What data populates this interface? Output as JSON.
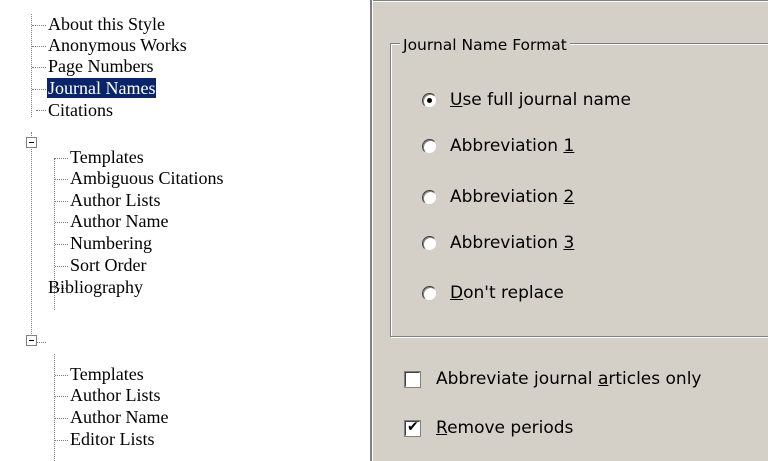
{
  "tree": {
    "items": [
      {
        "label": "About this Style"
      },
      {
        "label": "Anonymous Works"
      },
      {
        "label": "Page Numbers"
      },
      {
        "label": "Journal Names",
        "selected": true
      },
      {
        "label": "Citations",
        "expanded": true
      },
      {
        "label": "Templates"
      },
      {
        "label": "Ambiguous Citations"
      },
      {
        "label": "Author Lists"
      },
      {
        "label": "Author Name"
      },
      {
        "label": "Numbering"
      },
      {
        "label": "Sort Order"
      },
      {
        "label": "Bibliography",
        "expanded": true
      },
      {
        "label": "Templates"
      },
      {
        "label": "Author Lists"
      },
      {
        "label": "Author Name"
      },
      {
        "label": "Editor Lists"
      }
    ]
  },
  "journal_format": {
    "title": "Journal Name Format",
    "options": [
      {
        "pre": "",
        "ul": "U",
        "post": "se full journal name",
        "selected": true
      },
      {
        "pre": "Abbreviation ",
        "ul": "1",
        "post": "",
        "selected": false
      },
      {
        "pre": "Abbreviation ",
        "ul": "2",
        "post": "",
        "selected": false
      },
      {
        "pre": "Abbreviation ",
        "ul": "3",
        "post": "",
        "selected": false
      },
      {
        "pre": "",
        "ul": "D",
        "post": "on't replace",
        "selected": false
      }
    ]
  },
  "checks": [
    {
      "pre": "Abbreviate journal ",
      "ul": "a",
      "post": "rticles only",
      "checked": false
    },
    {
      "pre": "",
      "ul": "R",
      "post": "emove periods",
      "checked": true
    }
  ]
}
